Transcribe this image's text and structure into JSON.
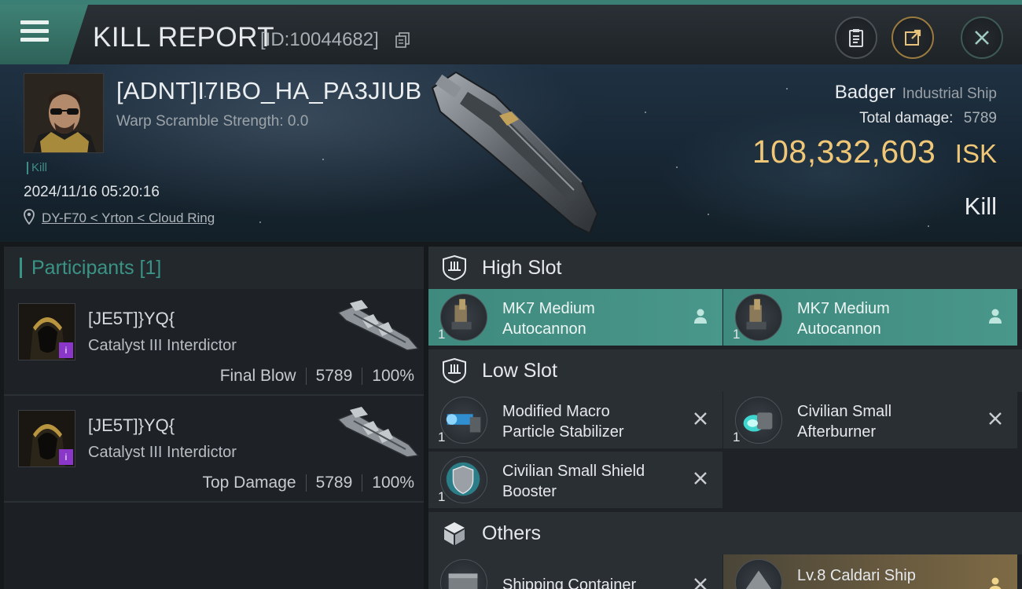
{
  "header": {
    "title": "KILL REPORT",
    "report_id": "[ID:10044682]"
  },
  "victim": {
    "name": "[ADNT]I7IBO_HA_PA3JIUB",
    "warp_scramble": "Warp Scramble Strength: 0.0",
    "kill_tag": "Kill",
    "timestamp": "2024/11/16 05:20:16",
    "location": "DY-F70 < Yrton < Cloud Ring",
    "ship_name": "Badger",
    "ship_class": "Industrial Ship",
    "total_damage_label": "Total damage:",
    "total_damage_value": "5789",
    "isk_value": "108,332,603",
    "isk_unit": "ISK",
    "result": "Kill"
  },
  "participants": {
    "title": "Participants [1]",
    "rows": [
      {
        "name": "[JE5T]}YQ{",
        "ship": "Catalyst III Interdictor",
        "role": "Final Blow",
        "damage": "5789",
        "percent": "100%"
      },
      {
        "name": "[JE5T]}YQ{",
        "ship": "Catalyst III Interdictor",
        "role": "Top Damage",
        "damage": "5789",
        "percent": "100%"
      }
    ]
  },
  "slots": {
    "high": {
      "label": "High Slot",
      "modules": [
        {
          "name_line1": "MK7 Medium",
          "name_line2": "Autocannon",
          "qty": "1",
          "state": "dropped"
        },
        {
          "name_line1": "MK7 Medium",
          "name_line2": "Autocannon",
          "qty": "1",
          "state": "dropped"
        }
      ]
    },
    "low": {
      "label": "Low Slot",
      "modules": [
        {
          "name_line1": "Modified Macro",
          "name_line2": "Particle Stabilizer",
          "qty": "1",
          "state": "destroyed"
        },
        {
          "name_line1": "Civilian Small",
          "name_line2": "Afterburner",
          "qty": "1",
          "state": "destroyed"
        },
        {
          "name_line1": "Civilian Small Shield",
          "name_line2": "Booster",
          "qty": "1",
          "state": "destroyed"
        }
      ]
    },
    "others": {
      "label": "Others",
      "modules": [
        {
          "name_line1": "Shipping Container",
          "name_line2": "",
          "qty": "",
          "state": "destroyed"
        },
        {
          "name_line1": "Lv.8 Caldari Ship",
          "name_line2": "",
          "qty": "",
          "state": "dropped"
        }
      ]
    }
  },
  "colors": {
    "accent": "#3a9485",
    "isk": "#f0c777",
    "rarity": "#8a36c9"
  },
  "icons": [
    "menu-icon",
    "copy-icon",
    "clipboard-icon",
    "share-icon",
    "close-icon",
    "location-pin-icon",
    "shield-slot-icon",
    "cube-icon",
    "person-icon",
    "x-icon"
  ]
}
